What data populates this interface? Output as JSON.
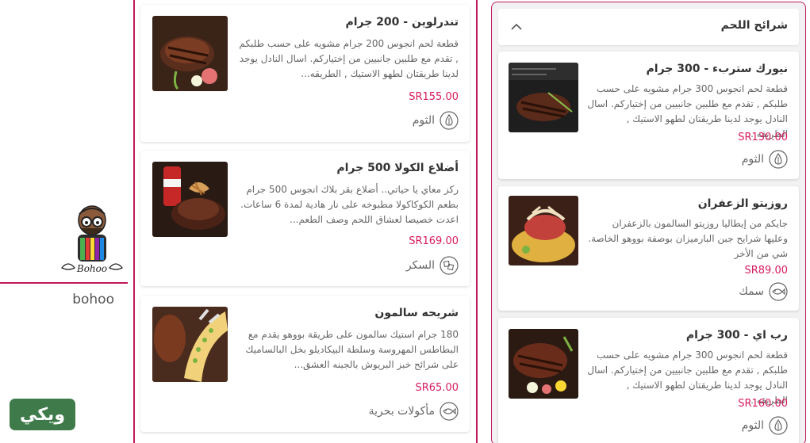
{
  "brand": {
    "name": "bohoo",
    "logo_text": "Bohoo",
    "badge_text": "ويكي"
  },
  "colors": {
    "accent": "#c2185b",
    "price": "#d81b60",
    "badge": "#3f7a4a"
  },
  "section": {
    "title": "شرائح اللحم",
    "chevron_icon": "chevron-up-icon"
  },
  "left_column": [
    {
      "title": "تندرلوين - 200 جرام",
      "description": "قطعة لحم انجوس 200 جرام مشويه على حسب طلبكم , تقدم مع طلبين جانبيين من إختياركم. اسال النادل يوجد لدينا طريقتان لطهو الاستيك , الطريقه...",
      "price": "SR155.00",
      "tag": "الثوم",
      "tag_icon": "garlic-icon"
    },
    {
      "title": "أضلاع الكولا 500 جرام",
      "description": "ركز معاي يا حياتي.. أضلاع بقر بلاك انجوس 500 جرام بطعم الكوكاكولا مطبوخه على نار هادية لمدة 6 ساعات. اعدت خصيصا لعشاق اللحم وصف الطعم...",
      "price": "SR169.00",
      "tag": "السكر",
      "tag_icon": "sugar-icon"
    },
    {
      "title": "شريحه سالمون",
      "description": "180 جرام استيك سالمون على طريقة بووهو يقدم مع البطاطس المهروسة وسلطة البيكاديلو بخل البالساميك على شرائح خبز البريوش بالجبنه العشق...",
      "price": "SR65.00",
      "tag": "مأكولات بحرية",
      "tag_icon": "seafood-icon"
    }
  ],
  "right_column": [
    {
      "title": "نيورك ستربء - 300 جرام",
      "description": "قطعة لحم انجوس 300 جرام مشويه على حسب طلبكم , تقدم مع طلبين جانبيين من إختياركم. اسال النادل يوجد لدينا طريقتان لطهو الاستيك , الطريقه...",
      "price": "SR130.00",
      "tag": "الثوم",
      "tag_icon": "garlic-icon"
    },
    {
      "title": "روزيتو الزعفران",
      "description": "جايكم من إيطاليا روزيتو السالمون بالزعفران وعليها شرايح جبن البارميزان بوصفة بووهو الخاصة. شي من الأخر",
      "price": "SR89.00",
      "tag": "سمك",
      "tag_icon": "fish-icon"
    },
    {
      "title": "رب اي - 300 جرام",
      "description": "قطعة لحم انجوس 300 جرام مشويه على حسب طلبكم , تقدم مع طلبين جانبيين من إختياركم. اسال النادل يوجد لدينا طريقتان لطهو الاستيك , الطريقه...",
      "price": "SR160.00",
      "tag": "الثوم",
      "tag_icon": "garlic-icon"
    }
  ]
}
